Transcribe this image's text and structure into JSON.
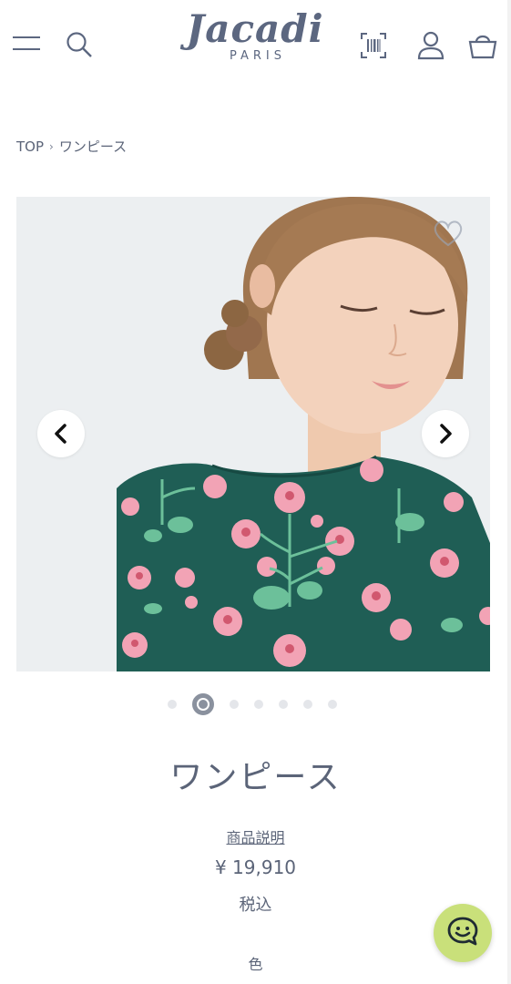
{
  "header": {
    "logo_main": "Jacadi",
    "logo_sub": "PARIS",
    "icons": [
      "menu-icon",
      "search-icon",
      "barcode-scan-icon",
      "user-icon",
      "shopping-basket-icon"
    ]
  },
  "breadcrumb": {
    "home": "TOP",
    "separator": "›",
    "current": "ワンピース"
  },
  "gallery": {
    "total_images": 7,
    "active_index": 1,
    "prev_icon": "chevron-left-icon",
    "next_icon": "chevron-right-icon",
    "favorite_icon": "heart-icon"
  },
  "product": {
    "title": "ワンピース",
    "description_link": "商品説明",
    "price": "¥ 19,910",
    "tax_note": "税込",
    "color_label": "色"
  },
  "chat": {
    "icon": "chat-bubble-icon",
    "color": "#c9e07a"
  },
  "colors": {
    "text": "#5b6478",
    "dress_green": "#1f5e55",
    "flower_pink": "#f2a3b5"
  }
}
